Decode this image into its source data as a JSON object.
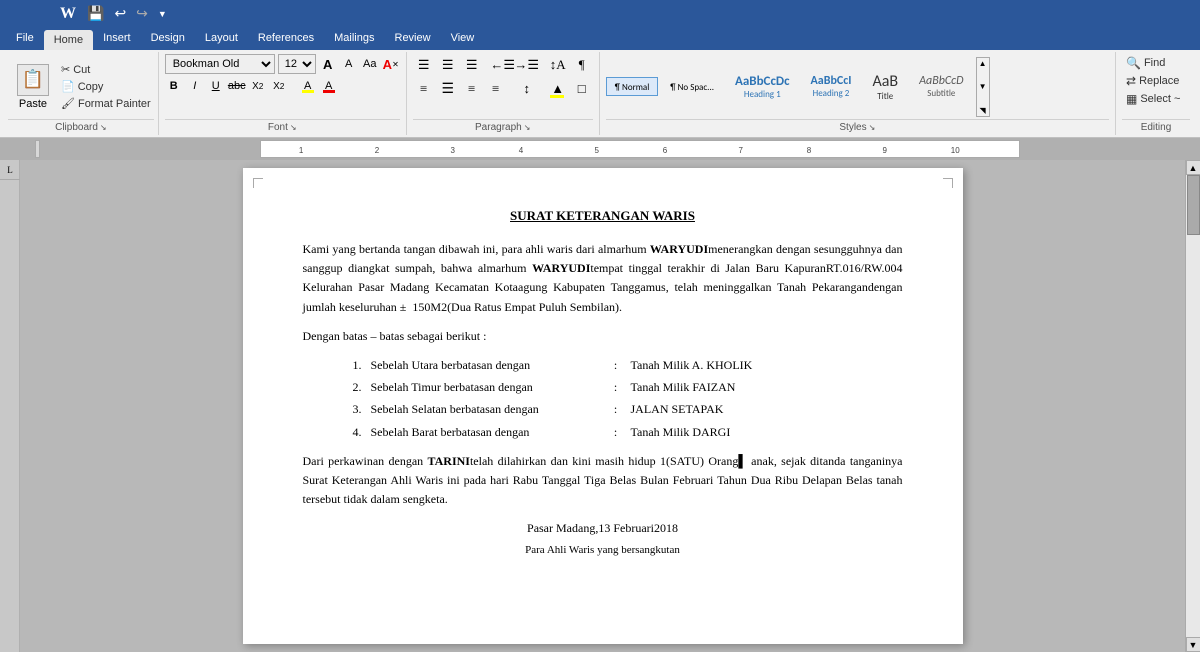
{
  "app": {
    "title": "Microsoft Word"
  },
  "ribbon": {
    "tabs": [
      "File",
      "Home",
      "Insert",
      "Design",
      "Layout",
      "References",
      "Mailings",
      "Review",
      "View"
    ],
    "active_tab": "Home"
  },
  "qat": {
    "save_label": "💾",
    "undo_label": "↩",
    "redo_label": "↪"
  },
  "clipboard": {
    "paste_label": "Paste",
    "cut_label": "Cut",
    "copy_label": "Copy",
    "format_painter_label": "Format Painter",
    "group_label": "Clipboard"
  },
  "font": {
    "font_name": "Bookman Old",
    "font_size": "12",
    "grow_label": "A",
    "shrink_label": "A",
    "case_label": "Aa",
    "clear_label": "A",
    "bold_label": "B",
    "italic_label": "I",
    "underline_label": "U",
    "strikethrough_label": "abc",
    "subscript_label": "X₂",
    "superscript_label": "X²",
    "text_color_label": "A",
    "highlight_label": "A",
    "group_label": "Font"
  },
  "paragraph": {
    "bullets_label": "≡",
    "numbering_label": "≡",
    "indent_less_label": "←",
    "indent_more_label": "→",
    "sort_label": "↕",
    "show_marks_label": "¶",
    "align_left_label": "≡",
    "align_center_label": "≡",
    "align_right_label": "≡",
    "justify_label": "≡",
    "line_spacing_label": "↕",
    "shading_label": "▲",
    "border_label": "□",
    "group_label": "Paragraph"
  },
  "styles": {
    "items": [
      {
        "name": "¶ Normal",
        "class": "style-normal"
      },
      {
        "name": "¶ No Spac...",
        "class": "style-nospace"
      },
      {
        "name": "Heading 1",
        "class": "style-h1"
      },
      {
        "name": "Heading 2",
        "class": "style-h2"
      },
      {
        "name": "Title",
        "class": "style-title"
      },
      {
        "name": "Subtitle",
        "class": "style-subtitle"
      }
    ],
    "group_label": "Styles"
  },
  "editing": {
    "find_label": "Find",
    "replace_label": "Replace",
    "select_label": "Select ~",
    "group_label": "Editing"
  },
  "document": {
    "title": "SURAT KETERANGAN WARIS",
    "paragraphs": [
      "Kami yang bertanda tangan dibawah ini, para ahli waris dari almarhum WARYUDImenerangkan dengan sesungguhnya dan sanggup diangkat sumpah, bahwa almarhum WARYUDItempat tinggal terakhir di Jalan Baru KapuranRT.016/RW.004 Kelurahan Pasar Madang Kecamatan Kotaagung Kabupaten Tanggamus, telah meninggalkan Tanah Pekarangandengan jumlah keseluruhan ± 150M2(Dua Ratus Empat Puluh Sembilan).",
      "Dengan batas – batas sebagai berikut :"
    ],
    "boundaries": [
      {
        "num": "1.",
        "label": "Sebelah Utara berbatasan dengan",
        "colon": ":",
        "value": "Tanah Milik A. KHOLIK"
      },
      {
        "num": "2.",
        "label": "Sebelah Timur berbatasan dengan",
        "colon": ":",
        "value": "Tanah Milik FAIZAN"
      },
      {
        "num": "3.",
        "label": "Sebelah Selatan berbatasan dengan",
        "colon": ":",
        "value": "JALAN SETAPAK"
      },
      {
        "num": "4.",
        "label": "Sebelah Barat berbatasan dengan",
        "colon": ":",
        "value": "Tanah Milik DARGI"
      }
    ],
    "paragraph3": "Dari perkawinan dengan TARINItelah dilahirkan dan kini masih hidup 1(SATU) Orang anak, sejak ditanda tanganinya Surat Keterangan Ahli Waris ini pada hari Rabu Tanggal Tiga Belas Bulan Februari Tahun Dua Ribu Delapan Belas tanah tersebut tidak dalam sengketa.",
    "place_date": "Pasar Madang,13 Februari2018",
    "footer_label": "Para Ahli Waris yang bersangkutan"
  }
}
